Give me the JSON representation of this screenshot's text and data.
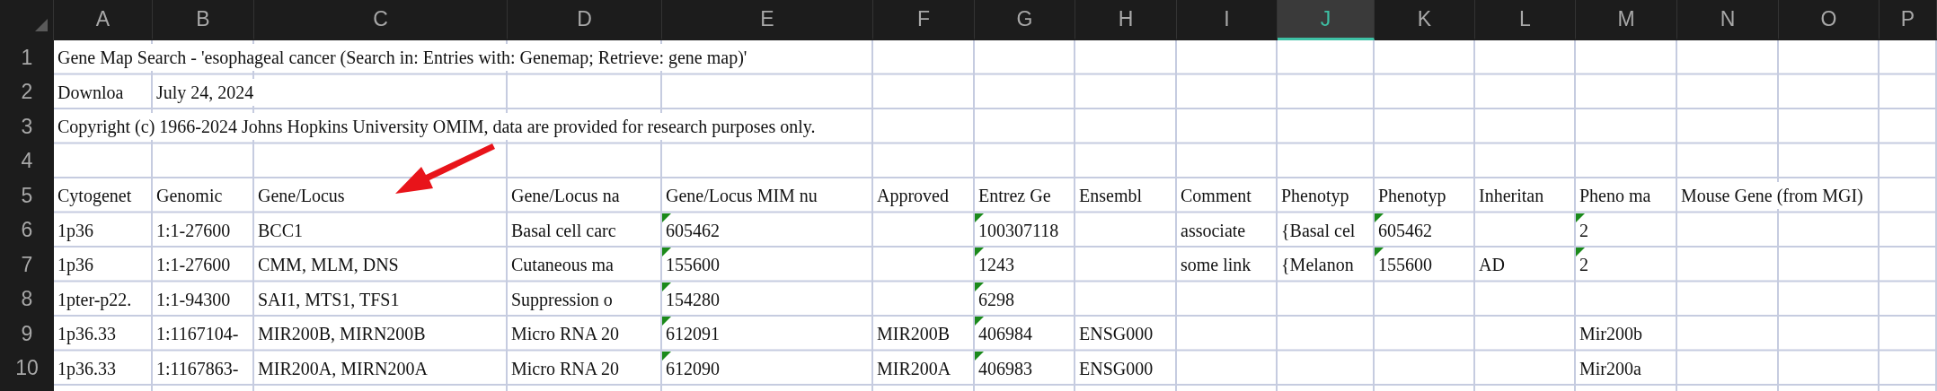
{
  "columns": [
    {
      "label": "A",
      "selected": false
    },
    {
      "label": "B",
      "selected": false
    },
    {
      "label": "C",
      "selected": false
    },
    {
      "label": "D",
      "selected": false
    },
    {
      "label": "E",
      "selected": false
    },
    {
      "label": "F",
      "selected": false
    },
    {
      "label": "G",
      "selected": false
    },
    {
      "label": "H",
      "selected": false
    },
    {
      "label": "I",
      "selected": false
    },
    {
      "label": "J",
      "selected": true
    },
    {
      "label": "K",
      "selected": false
    },
    {
      "label": "L",
      "selected": false
    },
    {
      "label": "M",
      "selected": false
    },
    {
      "label": "N",
      "selected": false
    },
    {
      "label": "O",
      "selected": false
    },
    {
      "label": "P",
      "selected": false
    }
  ],
  "rows": [
    {
      "number": "1",
      "cells": [
        "Gene Map Search - 'esophageal cancer (Search in: Entries with: Genemap; Retrieve: gene map)'",
        null,
        null,
        null,
        null,
        null,
        null,
        null,
        null,
        null,
        null,
        null,
        null,
        null,
        null,
        null
      ]
    },
    {
      "number": "2",
      "cells": [
        "Downloa",
        "July 24, 2024",
        null,
        null,
        null,
        null,
        null,
        null,
        null,
        null,
        null,
        null,
        null,
        null,
        null,
        null
      ]
    },
    {
      "number": "3",
      "cells": [
        "Copyright (c) 1966-2024 Johns Hopkins University OMIM, data are provided for research purposes only.",
        null,
        null,
        null,
        null,
        null,
        null,
        null,
        null,
        null,
        null,
        null,
        null,
        null,
        null,
        null
      ]
    },
    {
      "number": "4",
      "cells": [
        null,
        null,
        null,
        null,
        null,
        null,
        null,
        null,
        null,
        null,
        null,
        null,
        null,
        null,
        null,
        null
      ]
    },
    {
      "number": "5",
      "cells": [
        "Cytogenet",
        "Genomic",
        "Gene/Locus",
        "Gene/Locus na",
        "Gene/Locus MIM nu",
        "Approved",
        "Entrez Ge",
        "Ensembl",
        "Comment",
        "Phenotyp",
        "Phenotyp",
        "Inheritan",
        "Pheno ma",
        "Mouse Gene (from MGI)",
        null,
        null
      ]
    },
    {
      "number": "6",
      "cells": [
        "1p36",
        "1:1-27600",
        "BCC1",
        "Basal cell carc",
        {
          "text": "605462",
          "warning": true
        },
        null,
        {
          "text": "100307118",
          "warning": true
        },
        null,
        "associate",
        "{Basal cel",
        {
          "text": "605462",
          "warning": true
        },
        null,
        {
          "text": "2",
          "warning": true
        },
        null,
        null,
        null
      ]
    },
    {
      "number": "7",
      "cells": [
        "1p36",
        "1:1-27600",
        "CMM, MLM, DNS",
        "Cutaneous ma",
        {
          "text": "155600",
          "warning": true
        },
        null,
        {
          "text": "1243",
          "warning": true
        },
        null,
        "some link",
        "{Melanon",
        {
          "text": "155600",
          "warning": true
        },
        "AD",
        {
          "text": "2",
          "warning": true
        },
        null,
        null,
        null
      ]
    },
    {
      "number": "8",
      "cells": [
        "1pter-p22.",
        "1:1-94300",
        "SAI1, MTS1, TFS1",
        "Suppression o",
        {
          "text": "154280",
          "warning": true
        },
        null,
        {
          "text": "6298",
          "warning": true
        },
        null,
        null,
        null,
        null,
        null,
        null,
        null,
        null,
        null
      ]
    },
    {
      "number": "9",
      "cells": [
        "1p36.33",
        "1:1167104-",
        "MIR200B, MIRN200B",
        "Micro RNA 20",
        {
          "text": "612091",
          "warning": true
        },
        "MIR200B",
        {
          "text": "406984",
          "warning": true
        },
        "ENSG000",
        null,
        null,
        null,
        null,
        "Mir200b",
        null,
        null,
        null
      ]
    },
    {
      "number": "10",
      "cells": [
        "1p36.33",
        "1:1167863-",
        "MIR200A, MIRN200A",
        "Micro RNA 20",
        {
          "text": "612090",
          "warning": true
        },
        "MIR200A",
        {
          "text": "406983",
          "warning": true
        },
        "ENSG000",
        null,
        null,
        null,
        null,
        "Mir200a",
        null,
        null,
        null
      ]
    }
  ]
}
